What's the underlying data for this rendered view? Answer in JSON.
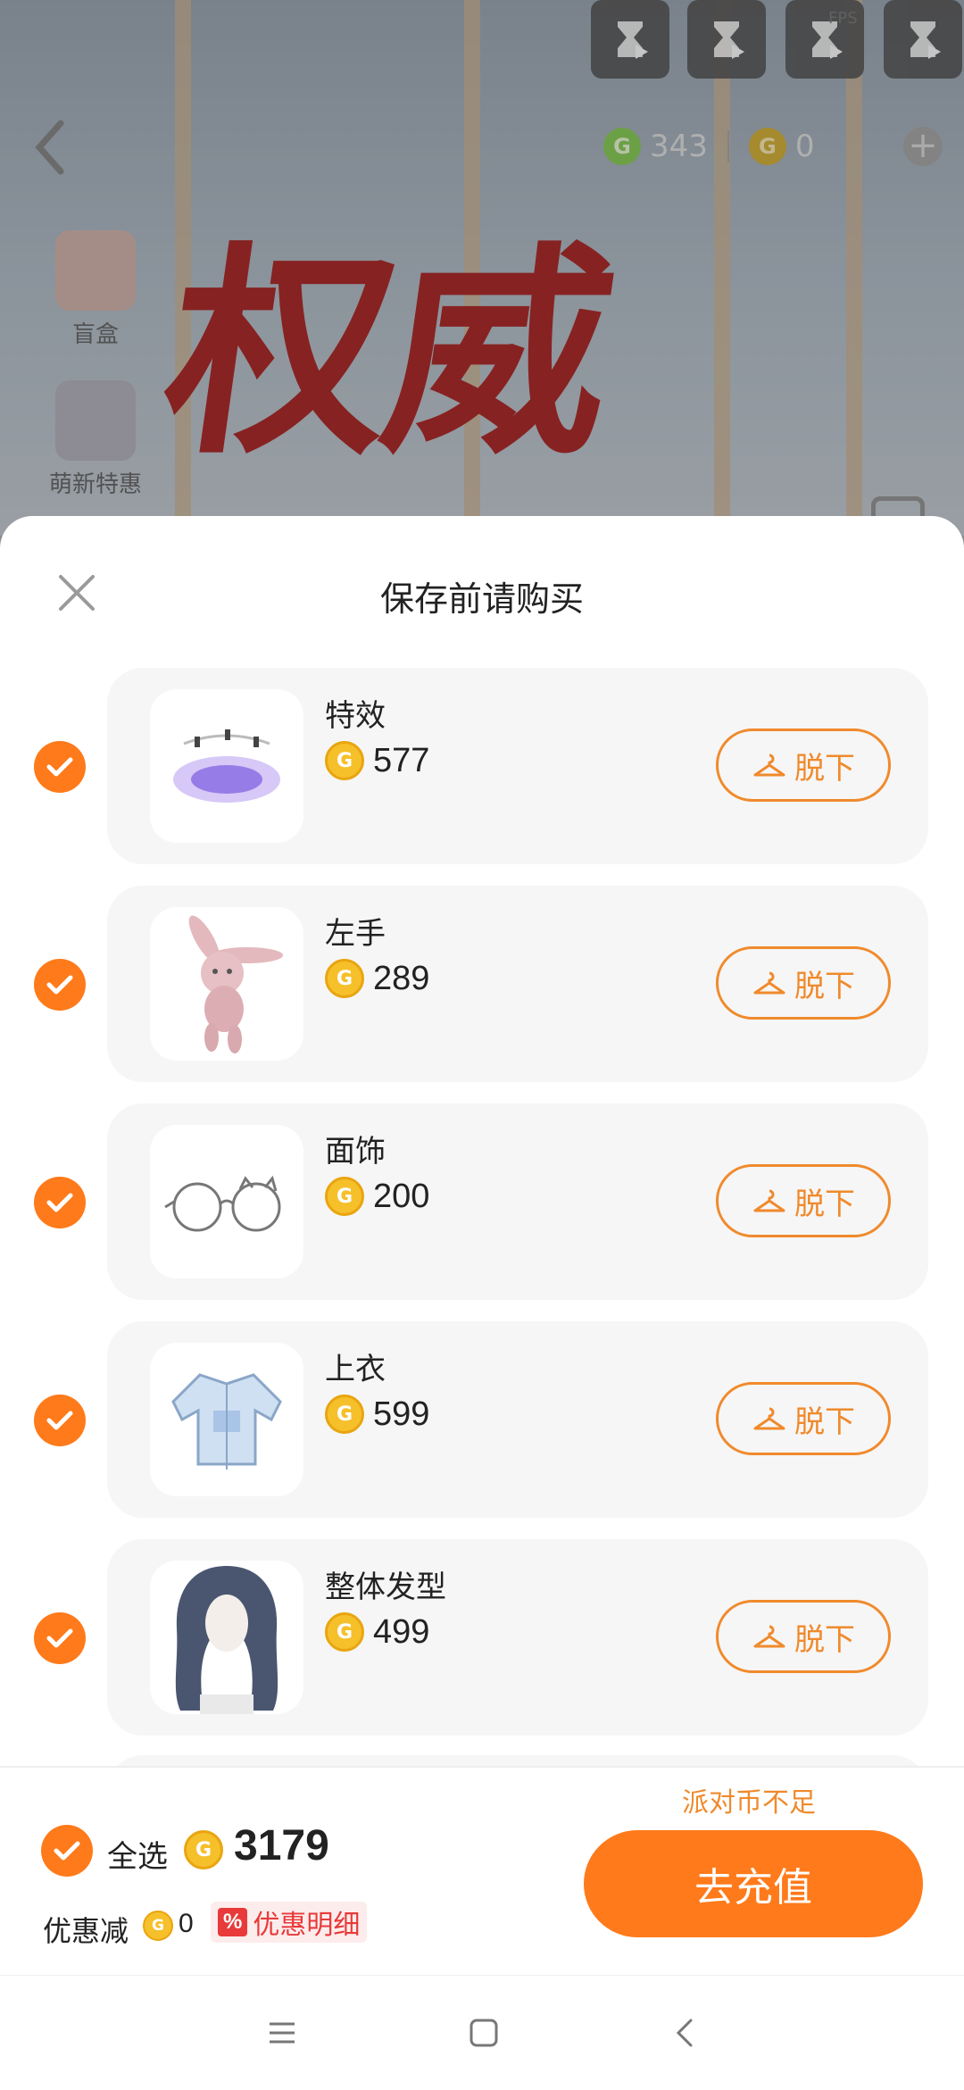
{
  "game": {
    "fps_label": "FPS",
    "currency_green": "343",
    "currency_gold": "0",
    "side_items": [
      {
        "label": "盲盒"
      },
      {
        "label": "萌新特惠"
      }
    ],
    "banner_text": "权威",
    "green_coin_glyph": "G",
    "gold_coin_glyph": "G"
  },
  "sheet": {
    "title": "保存前请购买",
    "coin_glyph": "G",
    "undress_label": "脱下",
    "items": [
      {
        "name": "特效",
        "price": "577"
      },
      {
        "name": "左手",
        "price": "289"
      },
      {
        "name": "面饰",
        "price": "200"
      },
      {
        "name": "上衣",
        "price": "599"
      },
      {
        "name": "整体发型",
        "price": "499"
      }
    ]
  },
  "footer": {
    "select_all_label": "全选",
    "total": "3179",
    "discount_label": "优惠减",
    "discount_value": "0",
    "discount_tag": "%",
    "discount_detail_label": "优惠明细",
    "insufficient_label": "派对币不足",
    "recharge_label": "去充值"
  },
  "colors": {
    "accent": "#ff7a1a",
    "accent_text": "#f08a2c",
    "coin": "#f6c02a"
  }
}
